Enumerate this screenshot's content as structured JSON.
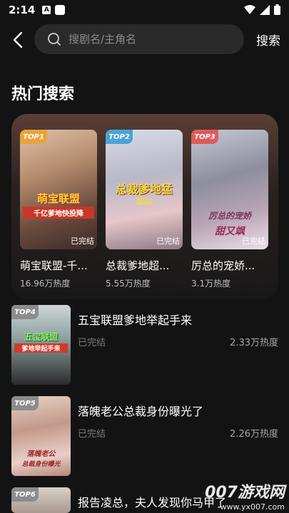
{
  "status_bar": {
    "time": "2:14",
    "icon_a": "A"
  },
  "search": {
    "placeholder": "搜剧名/主角名",
    "button": "搜索"
  },
  "section_title": "热门搜索",
  "top_cards": [
    {
      "rank": "TOP1",
      "title": "萌宝联盟-千...",
      "heat": "16.96万热度",
      "status": "已完结",
      "art_text": "萌宝联盟",
      "art_sub": "千亿爹地快投降",
      "badge_color": "#e8a33c"
    },
    {
      "rank": "TOP2",
      "title": "总裁爹地超...",
      "heat": "5.55万热度",
      "status": "已完结",
      "art_text": "总裁爹地猛",
      "art_sub": "超凶",
      "badge_color": "#4aa3d8"
    },
    {
      "rank": "TOP3",
      "title": "厉总的宠娇...",
      "heat": "3.1万热度",
      "status": "已完结",
      "art_text": "厉总的宠娇",
      "art_sub": "甜又飒",
      "badge_color": "#e05a5a"
    }
  ],
  "list_items": [
    {
      "rank": "TOP4",
      "title": "五宝联盟爹地举起手来",
      "status": "已完结",
      "heat": "2.33万热度",
      "art_text": "五宝联盟",
      "art_sub": "爹地举起手来"
    },
    {
      "rank": "TOP5",
      "title": "落魄老公总裁身份曝光了",
      "status": "已完结",
      "heat": "2.26万热度",
      "art_text": "落魄老公",
      "art_sub": "总裁身份曝光"
    },
    {
      "rank": "TOP6",
      "title": "报告凌总，夫人发现你马甲了",
      "status": "",
      "heat": "",
      "art_text": "",
      "art_sub": ""
    }
  ],
  "watermark": {
    "main": "007游戏网",
    "sub": "www.yx007.com"
  }
}
